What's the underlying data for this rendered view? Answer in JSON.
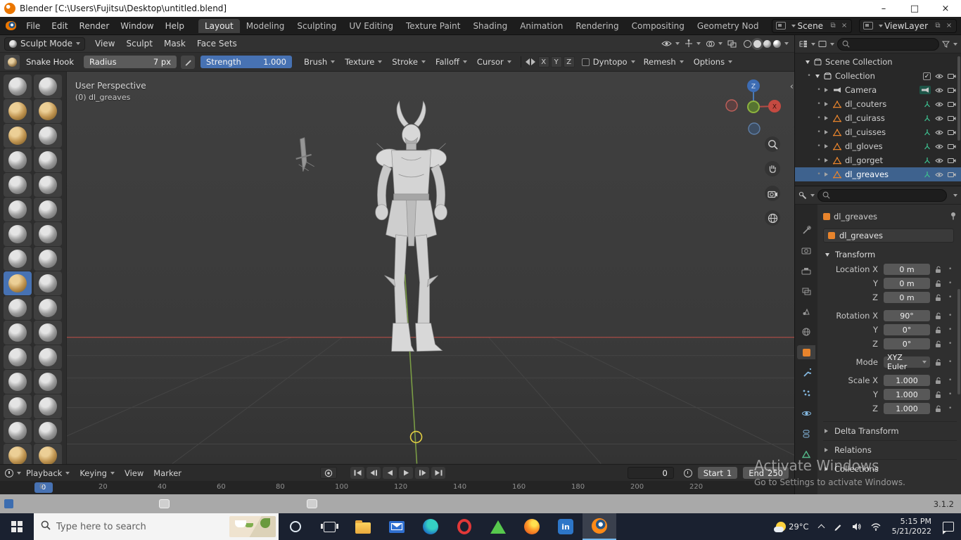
{
  "window": {
    "title": "Blender [C:\\Users\\Fujitsu\\Desktop\\untitled.blend]"
  },
  "menubar": {
    "menus": [
      "File",
      "Edit",
      "Render",
      "Window",
      "Help"
    ],
    "workspaces": [
      "Layout",
      "Modeling",
      "Sculpting",
      "UV Editing",
      "Texture Paint",
      "Shading",
      "Animation",
      "Rendering",
      "Compositing",
      "Geometry Nod"
    ],
    "active_workspace": "Layout",
    "scene_value": "Scene",
    "viewlayer_value": "ViewLayer"
  },
  "tool_header": {
    "mode": "Sculpt Mode",
    "menus": [
      "View",
      "Sculpt",
      "Mask",
      "Face Sets"
    ]
  },
  "tool_settings": {
    "brush_name": "Snake Hook",
    "radius_label": "Radius",
    "radius_value": "7 px",
    "strength_label": "Strength",
    "strength_value": "1.000",
    "popovers": [
      "Brush",
      "Texture",
      "Stroke",
      "Falloff",
      "Cursor"
    ],
    "mirror_axes": [
      "X",
      "Y",
      "Z"
    ],
    "dyntopo_label": "Dyntopo",
    "remesh_label": "Remesh",
    "options_label": "Options"
  },
  "brushes": {
    "active": "Snake Hook",
    "items": [
      "Draw",
      "Draw Sharp",
      "Clay",
      "Clay Strips",
      "Clay Thumb",
      "Layer",
      "Inflate",
      "Blob",
      "Crease",
      "Smooth",
      "Flatten",
      "Fill",
      "Scrape",
      "Multi-plane Scrape",
      "Pinch",
      "Grab",
      "Snake Hook",
      "Elastic Deform",
      "Thumb",
      "Pose",
      "Nudge",
      "Rotate",
      "Slide Relax",
      "Boundary",
      "Cloth",
      "Simplify",
      "Mask",
      "Draw Face Sets",
      "Multires Eraser",
      "Multires Smear",
      "Paint",
      "Smear"
    ]
  },
  "viewport": {
    "overlay_title": "User Perspective",
    "overlay_subtitle": "(0) dl_greaves",
    "gizmo_x": "X",
    "gizmo_z": "Z"
  },
  "outliner": {
    "root": "Scene Collection",
    "collection": "Collection",
    "objects": [
      "Camera",
      "dl_couters",
      "dl_cuirass",
      "dl_cuisses",
      "dl_gloves",
      "dl_gorget",
      "dl_greaves"
    ],
    "selected": "dl_greaves"
  },
  "properties": {
    "breadcrumb_object": "dl_greaves",
    "name_field": "dl_greaves",
    "transform_title": "Transform",
    "transform_rows": [
      {
        "label": "Location X",
        "value": "0 m"
      },
      {
        "label": "Y",
        "value": "0 m"
      },
      {
        "label": "Z",
        "value": "0 m"
      },
      {
        "label": "Rotation X",
        "value": "90°",
        "group": true
      },
      {
        "label": "Y",
        "value": "0°"
      },
      {
        "label": "Z",
        "value": "0°"
      },
      {
        "label": "Mode",
        "value": "XYZ Euler",
        "select": true,
        "group": true
      },
      {
        "label": "Scale X",
        "value": "1.000",
        "group": true
      },
      {
        "label": "Y",
        "value": "1.000"
      },
      {
        "label": "Z",
        "value": "1.000"
      }
    ],
    "collapsed_sections": [
      "Delta Transform",
      "Relations",
      "Collections"
    ]
  },
  "timeline": {
    "menus": [
      "Playback",
      "Keying",
      "View",
      "Marker"
    ],
    "current_frame": "0",
    "playhead_label": "0",
    "start_label": "Start",
    "start_value": "1",
    "end_label": "End",
    "end_value": "250",
    "ruler_labels": [
      "0",
      "20",
      "40",
      "60",
      "80",
      "100",
      "120",
      "140",
      "160",
      "180",
      "200",
      "220"
    ]
  },
  "statusbar": {
    "version": "3.1.2"
  },
  "watermark": {
    "line1": "Activate Windows",
    "line2": "Go to Settings to activate Windows."
  },
  "taskbar": {
    "search_placeholder": "Type here to search",
    "weather_temp": "29°C",
    "linkedin_glyph": "in",
    "clock_time": "5:15 PM",
    "clock_date": "5/21/2022"
  }
}
